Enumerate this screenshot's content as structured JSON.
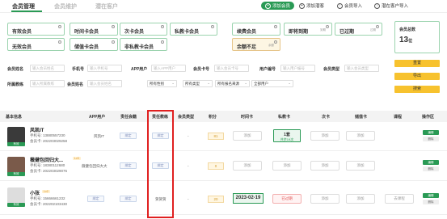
{
  "tabs": [
    {
      "label": "会员管理"
    },
    {
      "label": "会员维护"
    },
    {
      "label": "潜在客户"
    }
  ],
  "top_buttons": {
    "add": "添加会员",
    "add_pending": "添加潜客",
    "import": "会员导入",
    "import_leads": "潜在客户导入"
  },
  "cards": [
    {
      "label": "有效会员"
    },
    {
      "label": "无效会员"
    },
    {
      "label": "时间卡会员"
    },
    {
      "label": "储值卡会员"
    },
    {
      "label": "次卡会员"
    },
    {
      "label": "非私教卡会员"
    },
    {
      "label": "私教卡会员"
    },
    {
      "label": "续费会员"
    },
    {
      "label": "余额不足",
      "extra": "余额"
    },
    {
      "label": "即将到期",
      "extra": "到期"
    },
    {
      "label": "已过期",
      "extra": "过期"
    }
  ],
  "stats": {
    "title": "会员总数",
    "value": "13",
    "unit": "位"
  },
  "side_buttons": {
    "reset": "重置",
    "export": "导出",
    "search": "搜索"
  },
  "filters": {
    "member_name": {
      "label": "会员姓名",
      "placeholder": "输入会员姓名"
    },
    "phone": {
      "label": "手机号",
      "placeholder": "输入手机号"
    },
    "app_user": {
      "label": "APP用户",
      "placeholder": "输入APP用户"
    },
    "card_no": {
      "label": "会员卡号",
      "placeholder": "输入会员卡号"
    },
    "user_no": {
      "label": "用户编号",
      "placeholder": "输入用户编号"
    },
    "member_type": {
      "label": "会员类型",
      "placeholder": "输入会员类型"
    },
    "coach": {
      "label": "所属教练",
      "placeholder": "输入所属教练"
    },
    "name": {
      "label": "会员姓名",
      "placeholder": "输入会员姓名"
    },
    "sel_gender": "所有性别",
    "sel_type": "所有类型",
    "sel_source": "所有报名来源",
    "sel_user": "全部用户"
  },
  "columns": [
    "基本信息",
    "APP用户",
    "责任会籍",
    "责任教练",
    "会员类型",
    "积分",
    "时间卡",
    "私教卡",
    "次卡",
    "储值卡",
    "课程",
    "操作区"
  ],
  "rows": [
    {
      "name": "风凯IT",
      "level": "",
      "phone": "手机号: 13880557230",
      "card": "会员卡: 202203029258",
      "app": "风凯IT",
      "coach": "绑定",
      "member": "绑定",
      "type": "-",
      "points": "81",
      "time": "添加",
      "pt": "1套",
      "pt2": "共余19次",
      "count": "添加",
      "store": "添加",
      "avatar_label": "有效",
      "edit": "编辑",
      "del": "删除"
    },
    {
      "name": "薇健包回归大...",
      "level": "Lv3",
      "phone": "手机号: 18380112680",
      "card": "会员卡: 202203029076",
      "app": "薇健包回归大大",
      "coach": "绑定",
      "member": "绑定",
      "type": "-",
      "points": "0",
      "time": "添加",
      "pt": "添加",
      "count": "添加",
      "store": "添加",
      "avatar_label": "有效",
      "edit": "编辑",
      "del": "删除"
    },
    {
      "name": "小张",
      "level": "Lv2",
      "phone": "手机号: 15666661232",
      "card": "会员卡: 202202103430",
      "app": "绑定",
      "coach": "绑定",
      "member": "贺贺贺",
      "type": "-",
      "points": "20",
      "time": "2023-02-19",
      "pt": "已过期",
      "count": "添加",
      "store": "添加",
      "course": "去课程",
      "avatar_label": "有效",
      "edit": "编辑",
      "del": "删除"
    }
  ]
}
